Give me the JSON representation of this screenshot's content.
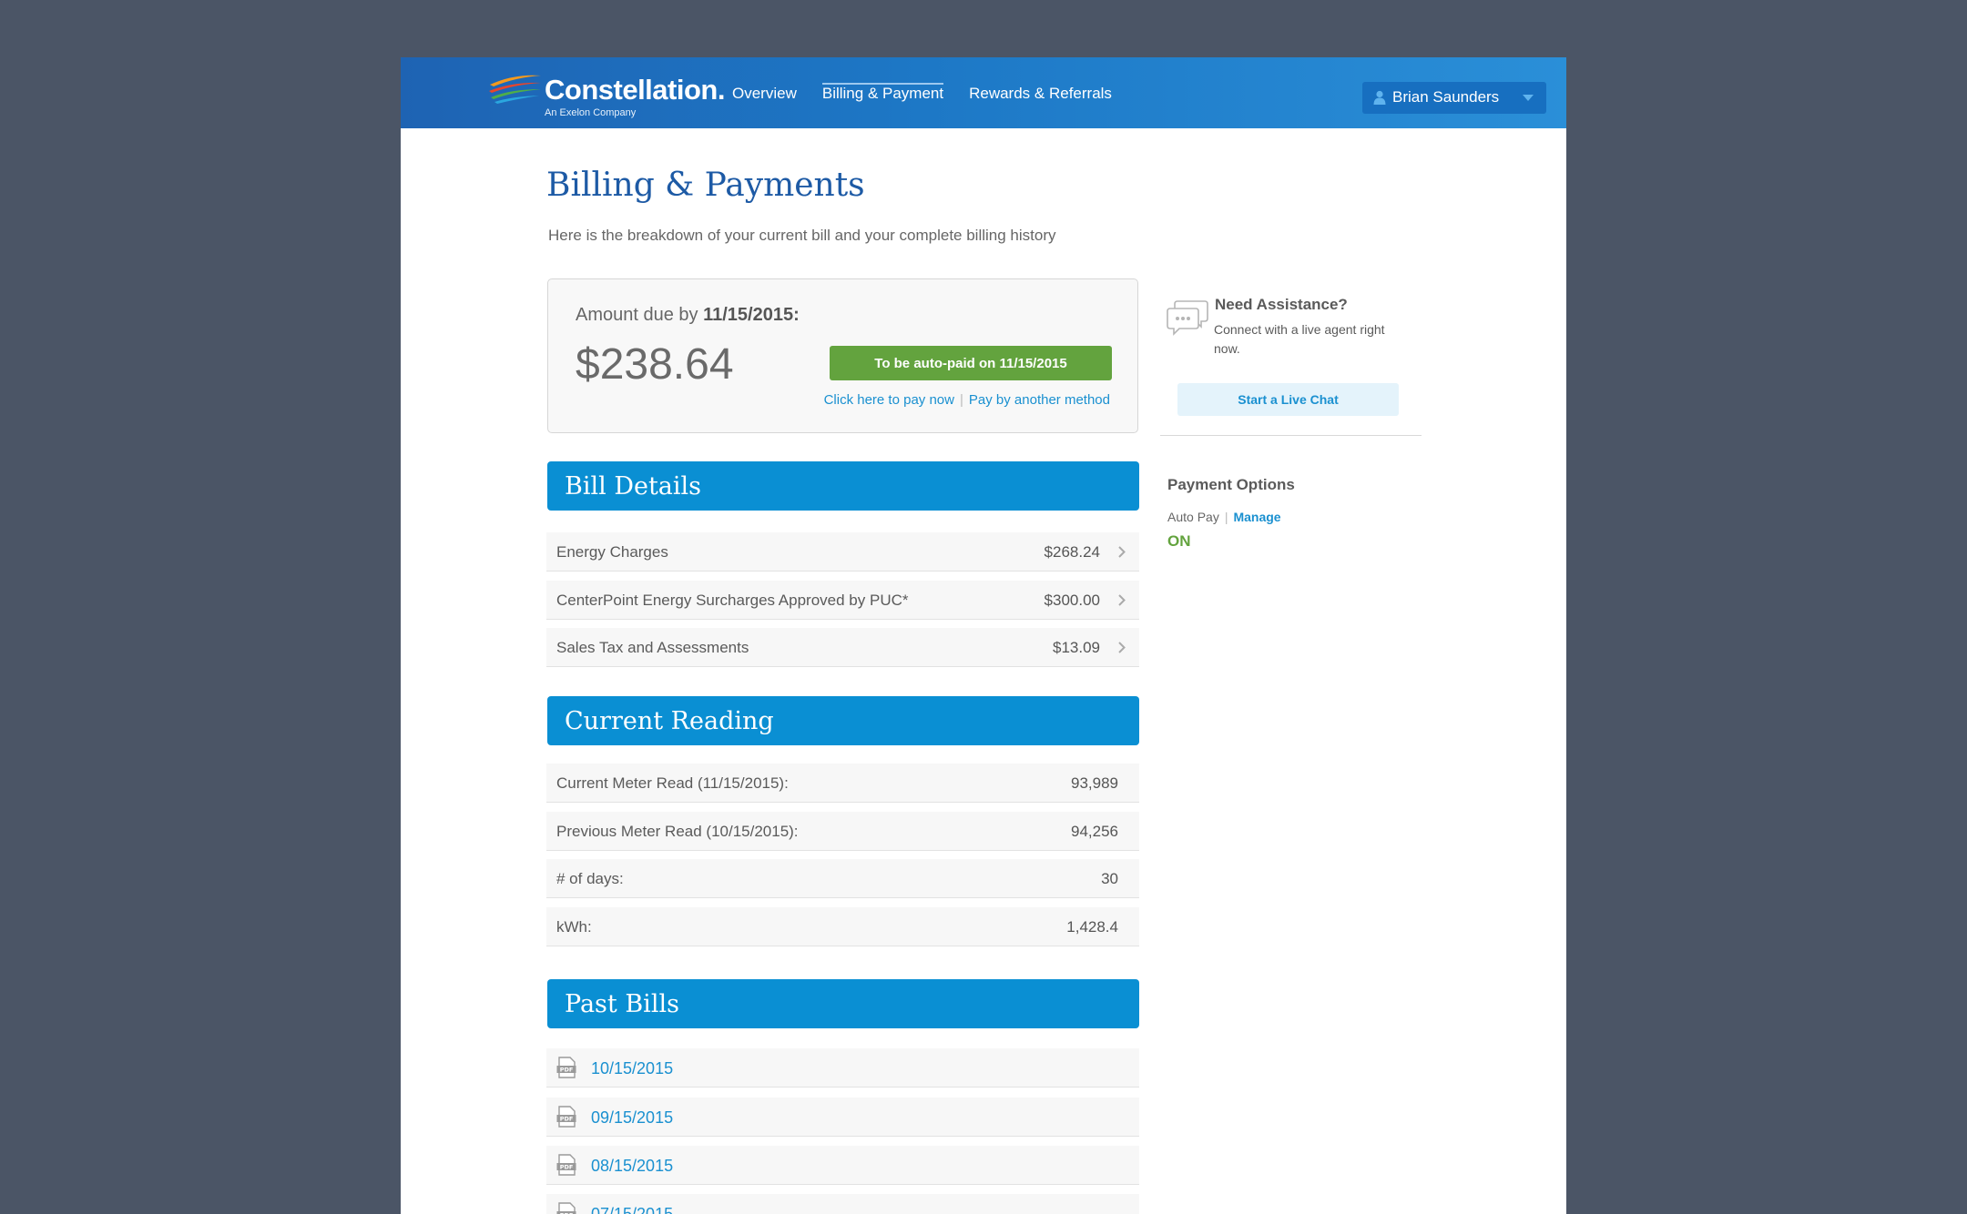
{
  "header": {
    "brand": "Constellation.",
    "brand_sub": "An Exelon Company",
    "nav": [
      "Overview",
      "Billing & Payment",
      "Rewards & Referrals"
    ],
    "active_nav": "Billing & Payment",
    "user_name": "Brian Saunders"
  },
  "page": {
    "title": "Billing & Payments",
    "subtitle": "Here is the breakdown of your current bill and your complete billing history"
  },
  "amount_due": {
    "label": "Amount due by",
    "date": "11/15/2015:",
    "amount": "$238.64",
    "autopaid_label": "To be auto-paid on 11/15/2015",
    "pay_now_link": "Click here to pay now",
    "separator": "|",
    "pay_other_link": "Pay by another method"
  },
  "bill_details": {
    "title": "Bill Details",
    "items": [
      {
        "label": "Energy Charges",
        "amount": "$268.24"
      },
      {
        "label": "CenterPoint Energy Surcharges Approved by PUC*",
        "amount": "$300.00"
      },
      {
        "label": "Sales Tax and Assessments",
        "amount": "$13.09"
      }
    ]
  },
  "current_reading": {
    "title": "Current Reading",
    "items": [
      {
        "label": "Current Meter Read (11/15/2015):",
        "value": "93,989"
      },
      {
        "label": "Previous Meter Read (10/15/2015):",
        "value": "94,256"
      },
      {
        "label": "# of days:",
        "value": "30"
      },
      {
        "label": "kWh:",
        "value": "1,428.4"
      }
    ]
  },
  "past_bills": {
    "title": "Past Bills",
    "items": [
      "10/15/2015",
      "09/15/2015",
      "08/15/2015",
      "07/15/2015"
    ]
  },
  "sidebar": {
    "assist_title": "Need Assistance?",
    "assist_text": "Connect with a live agent right now.",
    "chat_button": "Start a Live Chat",
    "payment_options_title": "Payment Options",
    "auto_pay_label": "Auto Pay",
    "separator": "|",
    "manage_link": "Manage",
    "auto_pay_status": "ON"
  },
  "colors": {
    "header_blue": "#1d78c6",
    "section_blue": "#0a8fd3",
    "link_blue": "#1a90d0",
    "green": "#63a33e",
    "backdrop": "#4b5566"
  },
  "icons": [
    "constellation-logo-icon",
    "user-icon",
    "caret-down-icon",
    "chevron-right-icon",
    "pdf-icon",
    "chat-bubble-icon"
  ]
}
